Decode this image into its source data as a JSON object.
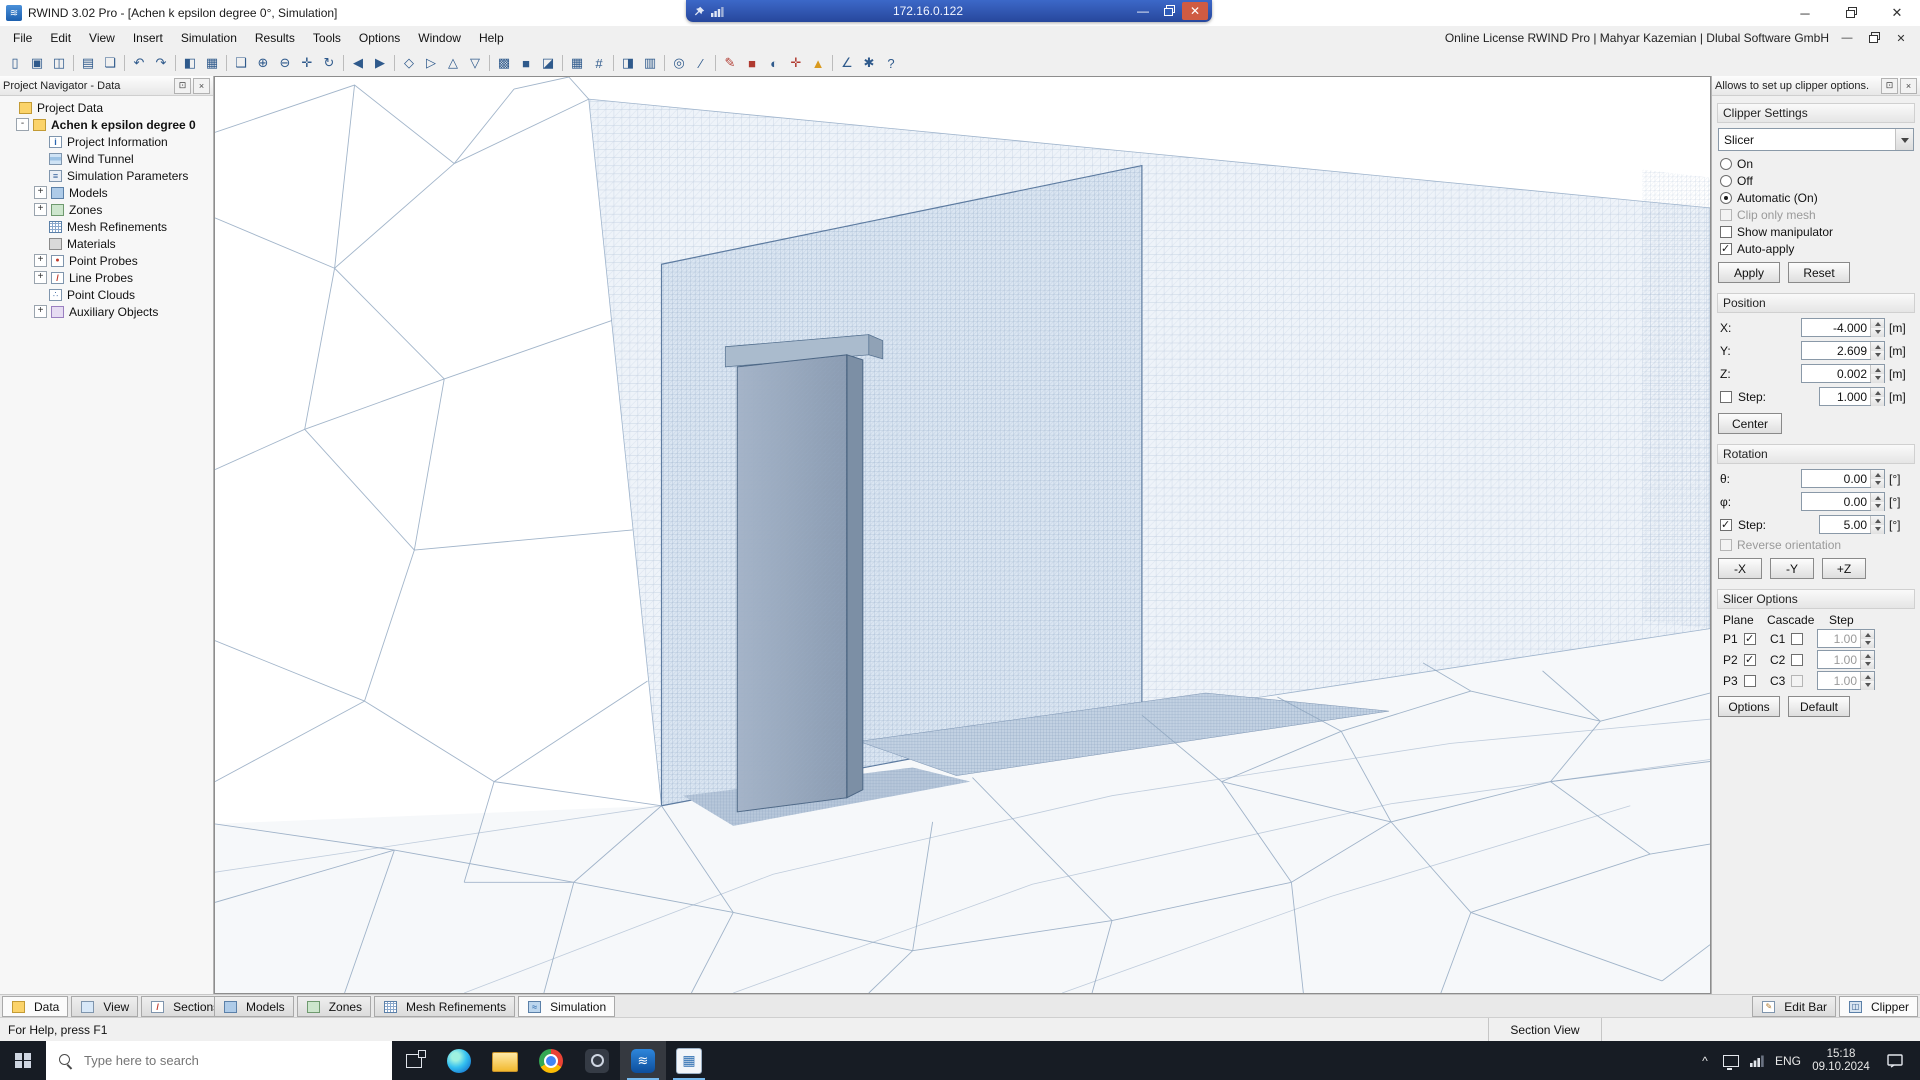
{
  "window": {
    "title": "RWIND 3.02 Pro - [Achen k epsilon degree 0°, Simulation]"
  },
  "remote_bar": {
    "address": "172.16.0.122"
  },
  "menu": {
    "items": [
      "File",
      "Edit",
      "View",
      "Insert",
      "Simulation",
      "Results",
      "Tools",
      "Options",
      "Window",
      "Help"
    ],
    "license": "Online License RWIND Pro | Mahyar Kazemian | Dlubal Software GmbH"
  },
  "toolbar": {
    "icons": [
      {
        "n": "new-file-icon",
        "g": "▯",
        "cls": ""
      },
      {
        "n": "open-file-icon",
        "g": "▣",
        "cls": ""
      },
      {
        "n": "save-file-icon",
        "g": "◫",
        "cls": ""
      },
      {
        "n": "toolbar-separator",
        "g": "",
        "cls": "sep",
        "inter": "false"
      },
      {
        "n": "print-icon",
        "g": "▤",
        "cls": ""
      },
      {
        "n": "copy-image-icon",
        "g": "❏",
        "cls": ""
      },
      {
        "n": "toolbar-separator",
        "g": "",
        "cls": "sep",
        "inter": "false"
      },
      {
        "n": "undo-icon",
        "g": "↶",
        "cls": ""
      },
      {
        "n": "redo-icon",
        "g": "↷",
        "cls": ""
      },
      {
        "n": "toolbar-separator",
        "g": "",
        "cls": "sep",
        "inter": "false"
      },
      {
        "n": "navigator-toggle-icon",
        "g": "◧",
        "cls": ""
      },
      {
        "n": "tables-icon",
        "g": "▦",
        "cls": ""
      },
      {
        "n": "toolbar-separator",
        "g": "",
        "cls": "sep",
        "inter": "false"
      },
      {
        "n": "zoom-window-icon",
        "g": "❑",
        "cls": ""
      },
      {
        "n": "zoom-in-icon",
        "g": "⊕",
        "cls": ""
      },
      {
        "n": "zoom-out-icon",
        "g": "⊖",
        "cls": ""
      },
      {
        "n": "pan-view-icon",
        "g": "✛",
        "cls": ""
      },
      {
        "n": "rotate-view-icon",
        "g": "↻",
        "cls": ""
      },
      {
        "n": "toolbar-separator",
        "g": "",
        "cls": "sep",
        "inter": "false"
      },
      {
        "n": "previous-view-icon",
        "g": "◀",
        "cls": ""
      },
      {
        "n": "next-view-icon",
        "g": "▶",
        "cls": ""
      },
      {
        "n": "toolbar-separator",
        "g": "",
        "cls": "sep",
        "inter": "false"
      },
      {
        "n": "isometric-view-icon",
        "g": "◇",
        "cls": ""
      },
      {
        "n": "view-x-icon",
        "g": "▷",
        "cls": ""
      },
      {
        "n": "view-y-icon",
        "g": "△",
        "cls": ""
      },
      {
        "n": "view-z-icon",
        "g": "▽",
        "cls": ""
      },
      {
        "n": "toolbar-separator",
        "g": "",
        "cls": "sep",
        "inter": "false"
      },
      {
        "n": "wireframe-display-icon",
        "g": "▩",
        "cls": ""
      },
      {
        "n": "solid-display-icon",
        "g": "■",
        "cls": ""
      },
      {
        "n": "section-display-icon",
        "g": "◪",
        "cls": ""
      },
      {
        "n": "toolbar-separator",
        "g": "",
        "cls": "sep",
        "inter": "false"
      },
      {
        "n": "show-mesh-icon",
        "g": "▦",
        "cls": ""
      },
      {
        "n": "show-numbering-icon",
        "g": "#",
        "cls": ""
      },
      {
        "n": "toolbar-separator",
        "g": "",
        "cls": "sep",
        "inter": "false"
      },
      {
        "n": "clipper-icon",
        "g": "◨",
        "cls": ""
      },
      {
        "n": "slicer-icon",
        "g": "▥",
        "cls": ""
      },
      {
        "n": "toolbar-separator",
        "g": "",
        "cls": "sep",
        "inter": "false"
      },
      {
        "n": "point-probe-icon",
        "g": "◎",
        "cls": ""
      },
      {
        "n": "line-probe-icon",
        "g": "∕",
        "cls": ""
      },
      {
        "n": "toolbar-separator",
        "g": "",
        "cls": "sep",
        "inter": "false"
      },
      {
        "n": "edit-mode-icon",
        "g": "✎",
        "cls": "red"
      },
      {
        "n": "stop-simulation-icon",
        "g": "■",
        "cls": "red"
      },
      {
        "n": "results-display-icon",
        "g": "◐",
        "cls": ""
      },
      {
        "n": "probe-values-icon",
        "g": "✛",
        "cls": "red"
      },
      {
        "n": "warnings-icon",
        "g": "▲",
        "cls": "yellow"
      },
      {
        "n": "toolbar-separator",
        "g": "",
        "cls": "sep",
        "inter": "false"
      },
      {
        "n": "measure-icon",
        "g": "∠",
        "cls": ""
      },
      {
        "n": "settings-icon",
        "g": "✱",
        "cls": ""
      },
      {
        "n": "help-icon",
        "g": "?",
        "cls": ""
      }
    ]
  },
  "navigator": {
    "header": "Project Navigator - Data",
    "items": [
      {
        "label": "Project Data",
        "lvl": "lvl0",
        "exp": "",
        "icon": "folder",
        "b": ""
      },
      {
        "label": "Achen k epsilon degree 0",
        "lvl": "lvl1",
        "exp": "-",
        "icon": "folder",
        "b": "bold"
      },
      {
        "label": "Project Information",
        "lvl": "lvl2",
        "exp": "",
        "icon": "info",
        "b": ""
      },
      {
        "label": "Wind Tunnel",
        "lvl": "lvl2",
        "exp": "",
        "icon": "wind",
        "b": ""
      },
      {
        "label": "Simulation Parameters",
        "lvl": "lvl2",
        "exp": "",
        "icon": "params",
        "b": ""
      },
      {
        "label": "Models",
        "lvl": "lvl2",
        "exp": "+",
        "icon": "models",
        "b": ""
      },
      {
        "label": "Zones",
        "lvl": "lvl2",
        "exp": "+",
        "icon": "zones",
        "b": ""
      },
      {
        "label": "Mesh Refinements",
        "lvl": "lvl2",
        "exp": "",
        "icon": "mesh",
        "b": ""
      },
      {
        "label": "Materials",
        "lvl": "lvl2",
        "exp": "",
        "icon": "materials",
        "b": ""
      },
      {
        "label": "Point Probes",
        "lvl": "lvl2",
        "exp": "+",
        "icon": "pprobes",
        "b": ""
      },
      {
        "label": "Line Probes",
        "lvl": "lvl2",
        "exp": "+",
        "icon": "lprobes",
        "b": ""
      },
      {
        "label": "Point Clouds",
        "lvl": "lvl2",
        "exp": "",
        "icon": "pclouds",
        "b": ""
      },
      {
        "label": "Auxiliary Objects",
        "lvl": "lvl2",
        "exp": "+",
        "icon": "aux",
        "b": ""
      }
    ]
  },
  "clipper": {
    "hint": "Allows to set up clipper options.",
    "settings_header": "Clipper Settings",
    "type_value": "Slicer",
    "radio_on": "On",
    "radio_off": "Off",
    "radio_auto": "Automatic (On)",
    "check_clip_only": "Clip only mesh",
    "check_show_manip": "Show manipulator",
    "check_auto_apply": "Auto-apply",
    "apply": "Apply",
    "reset": "Reset",
    "position_header": "Position",
    "pos": {
      "x_label": "X:",
      "x": "-4.000",
      "y_label": "Y:",
      "y": "2.609",
      "z_label": "Z:",
      "z": "0.002",
      "step_label": "Step:",
      "step": "1.000",
      "unit": "[m]"
    },
    "center": "Center",
    "rotation_header": "Rotation",
    "rot": {
      "theta_label": "θ:",
      "theta": "0.00",
      "phi_label": "φ:",
      "phi": "0.00",
      "step_label": "Step:",
      "step": "5.00",
      "unit": "[°]",
      "reverse": "Reverse orientation"
    },
    "minus_x": "-X",
    "minus_y": "-Y",
    "plus_z": "+Z",
    "slicer_header": "Slicer Options",
    "table": {
      "col_plane": "Plane",
      "col_cascade": "Cascade",
      "col_step": "Step",
      "rows": [
        {
          "p": "P1",
          "c": "C1",
          "v": "1.00",
          "pcls": "checked",
          "ccls": "",
          "vcls": "disabled"
        },
        {
          "p": "P2",
          "c": "C2",
          "v": "1.00",
          "pcls": "checked",
          "ccls": "",
          "vcls": "disabled"
        },
        {
          "p": "P3",
          "c": "C3",
          "v": "1.00",
          "pcls": "",
          "ccls": "disabled",
          "vcls": "disabled"
        }
      ]
    },
    "options": "Options",
    "default": "Default"
  },
  "bottom_tabs": {
    "left": [
      {
        "label": "Data",
        "icon": "data",
        "cls": "active"
      },
      {
        "label": "View",
        "icon": "viewt",
        "cls": ""
      },
      {
        "label": "Sections",
        "icon": "sections",
        "cls": ""
      }
    ],
    "center": [
      {
        "label": "Models",
        "icon": "models",
        "cls": ""
      },
      {
        "label": "Zones",
        "icon": "zones",
        "cls": ""
      },
      {
        "label": "Mesh Refinements",
        "icon": "mesh",
        "cls": ""
      },
      {
        "label": "Simulation",
        "icon": "simulation",
        "cls": "active"
      }
    ],
    "right": [
      {
        "label": "Edit Bar",
        "icon": "editbar",
        "cls": ""
      },
      {
        "label": "Clipper",
        "icon": "clipperic",
        "cls": "active"
      }
    ]
  },
  "status": {
    "help": "For Help, press F1",
    "view": "Section View"
  },
  "taskbar": {
    "search_placeholder": "Type here to search",
    "apps": [
      {
        "n": "taskbar-edge-icon",
        "app": "edge",
        "cls": ""
      },
      {
        "n": "taskbar-explorer-icon",
        "app": "explorer",
        "cls": ""
      },
      {
        "n": "taskbar-chrome-icon",
        "app": "chrome",
        "cls": ""
      },
      {
        "n": "taskbar-capture-tool-icon",
        "app": "tool",
        "cls": ""
      },
      {
        "n": "taskbar-rwind-icon",
        "app": "rwind",
        "cls": "active"
      },
      {
        "n": "taskbar-dlubal-app-icon",
        "app": "dlubal",
        "cls": "open"
      }
    ],
    "lang": "ENG",
    "time": "15:18",
    "date": "09.10.2024"
  }
}
